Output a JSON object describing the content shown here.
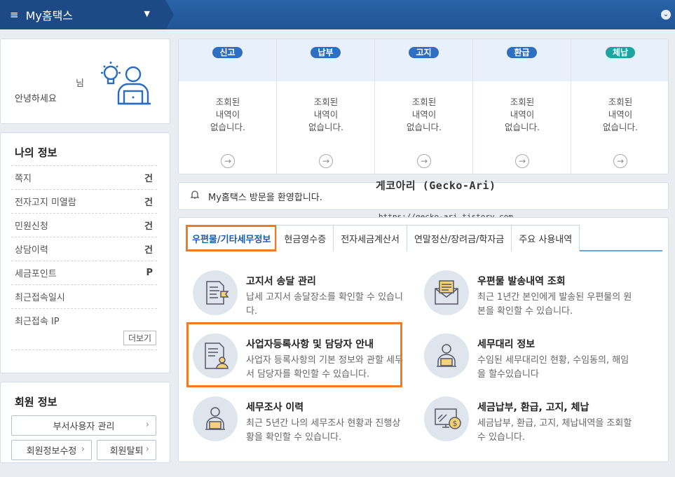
{
  "topbar": {
    "menu_label": "My홈택스",
    "collapse": "⌄"
  },
  "greeting": {
    "nim": "님",
    "hello": "안녕하세요"
  },
  "my_info": {
    "title": "나의 정보",
    "items": [
      {
        "label": "쪽지",
        "value": "건"
      },
      {
        "label": "전자고지 미열람",
        "value": "건"
      },
      {
        "label": "민원신청",
        "value": "건"
      },
      {
        "label": "상담이력",
        "value": "건"
      },
      {
        "label": "세금포인트",
        "value": "P"
      },
      {
        "label": "최근접속일시",
        "value": ""
      },
      {
        "label": "최근접속 IP",
        "value": ""
      }
    ],
    "more": "더보기"
  },
  "member_info": {
    "title": "회원 정보",
    "dept_user": "부서사용자 관리",
    "edit": "회원정보수정",
    "withdraw": "회원탈퇴"
  },
  "status": [
    {
      "badge": "신고",
      "color": "#2d6fc2",
      "l1": "조회된",
      "l2": "내역이",
      "l3": "없습니다."
    },
    {
      "badge": "납부",
      "color": "#2d6fc2",
      "l1": "조회된",
      "l2": "내역이",
      "l3": "없습니다."
    },
    {
      "badge": "고지",
      "color": "#2d6fc2",
      "l1": "조회된",
      "l2": "내역이",
      "l3": "없습니다."
    },
    {
      "badge": "환급",
      "color": "#2d6fc2",
      "l1": "조회된",
      "l2": "내역이",
      "l3": "없습니다."
    },
    {
      "badge": "체납",
      "color": "#1ca5a0",
      "l1": "조회된",
      "l2": "내역이",
      "l3": "없습니다."
    }
  ],
  "notice": "My홈택스 방문을 환영합니다.",
  "watermark": {
    "name": "게코아리 (Gecko-Ari)",
    "url": "https://gecko-ari.tistory.com"
  },
  "tabs": [
    "우편물/기타세무정보",
    "현금영수증",
    "전자세금계산서",
    "연말정산/장려금/학자금",
    "주요 사용내역"
  ],
  "services": [
    {
      "title": "고지서 송달 관리",
      "desc": "납세 고지서 송달장소를 확인할 수 있습니다."
    },
    {
      "title": "우편물 발송내역 조회",
      "desc": "최근 1년간 본인에게 발송된 우편물의 원본을 확인할 수 있습니다."
    },
    {
      "title": "사업자등록사항 및 담당자 안내",
      "desc": "사업자 등록사항의 기본 정보와 관할 세무서 담당자를 확인할 수 있습니다."
    },
    {
      "title": "세무대리 정보",
      "desc": "수임된 세무대리인 현황, 수임동의, 해임을 할수있습니다"
    },
    {
      "title": "세무조사 이력",
      "desc": "최근 5년간 나의 세무조사 현황과 진행상황을 확인할 수 있습니다."
    },
    {
      "title": "세금납부, 환급, 고지, 체납",
      "desc": "세금납부, 환급, 고지, 체납내역을 조회할 수 있습니다."
    }
  ]
}
